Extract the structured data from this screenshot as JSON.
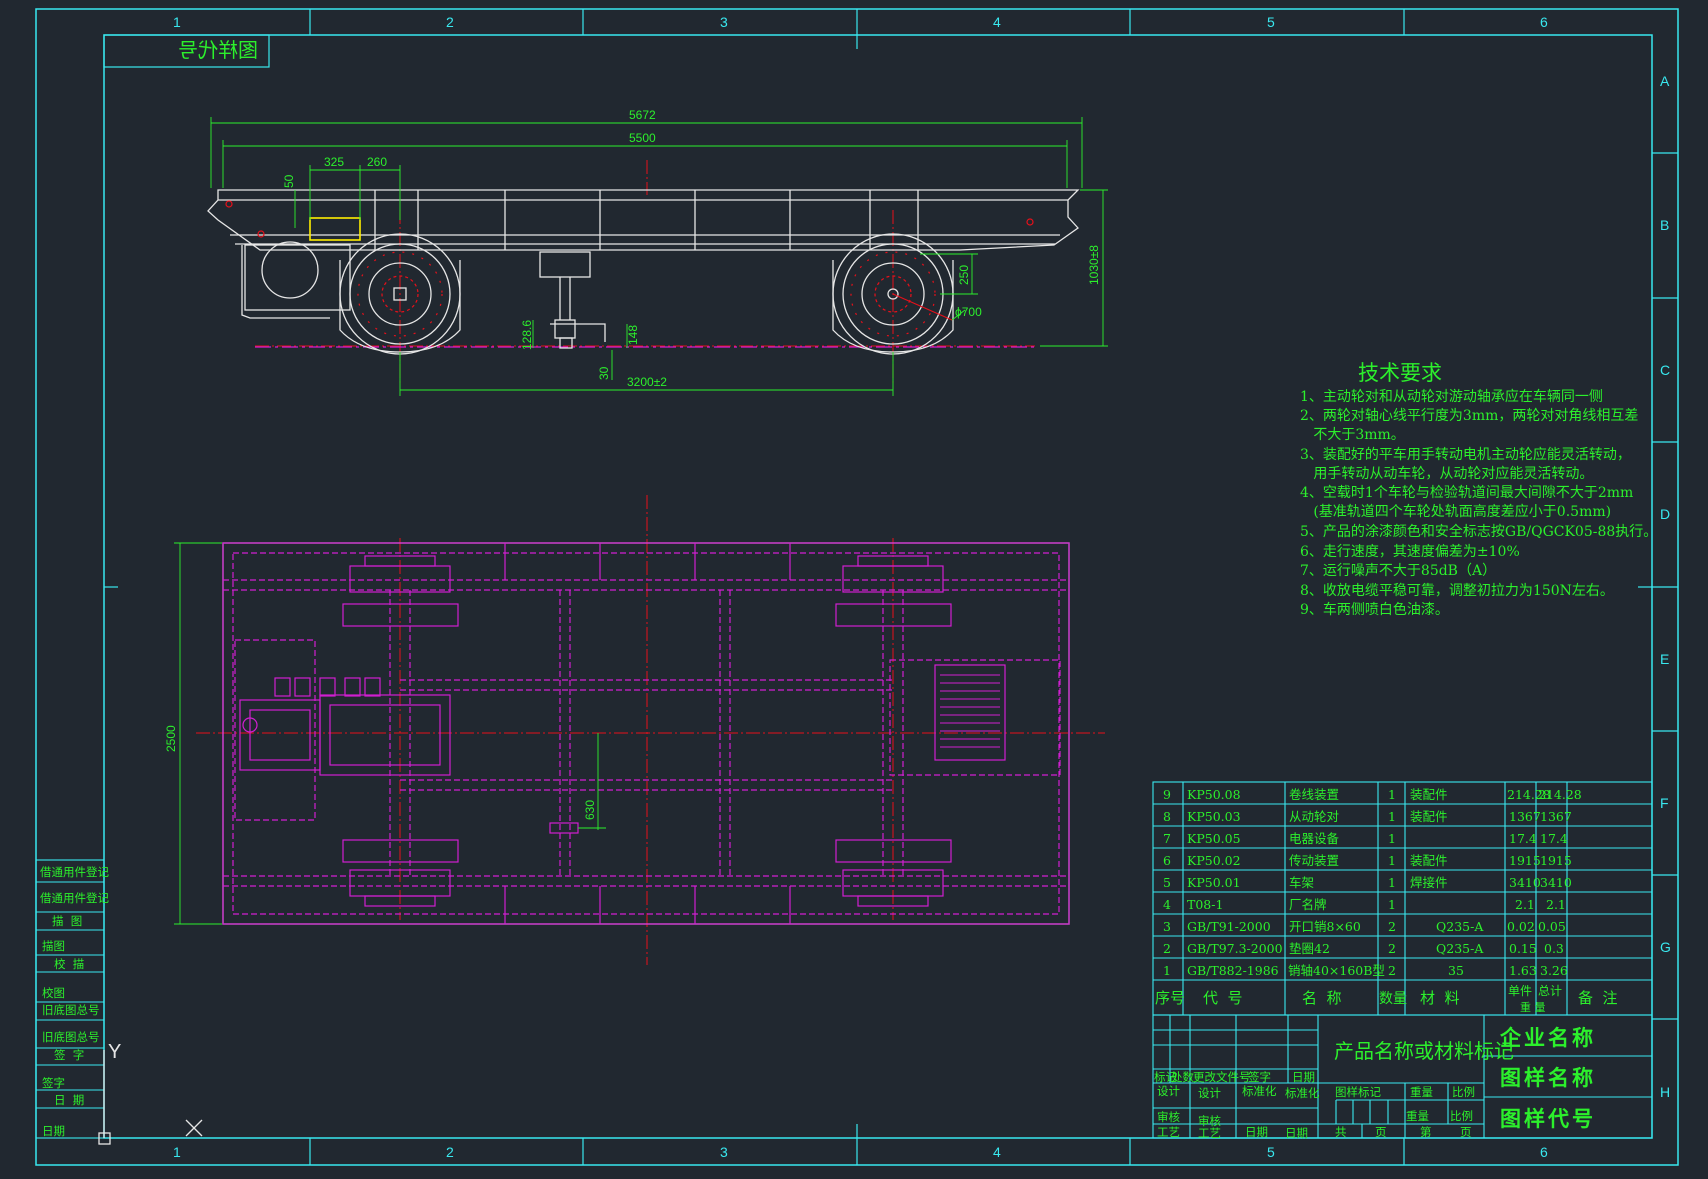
{
  "zone_columns": [
    "1",
    "2",
    "3",
    "4",
    "5",
    "6"
  ],
  "zone_rows": [
    "A",
    "B",
    "C",
    "D",
    "E",
    "F",
    "G",
    "H"
  ],
  "corner_mirrored_label": "图样代号",
  "dimensions": {
    "overall_length": "5672",
    "frame_length": "5500",
    "d325": "325",
    "d260": "260",
    "d50": "50",
    "height": "1030±8",
    "wheel_offset": "250",
    "wheel_dia": "ϕ700",
    "d128": "128.6",
    "d148": "148",
    "d30": "30",
    "wheelbase": "3200±2",
    "width": "2500",
    "d630": "630"
  },
  "tech_requirements": {
    "title": "技术要求",
    "lines": [
      "1、主动轮对和从动轮对游动轴承应在车辆同一侧",
      "2、两轮对轴心线平行度为3mm，两轮对对角线相互差",
      "   不大于3mm。",
      "3、装配好的平车用手转动电机主动轮应能灵活转动，",
      "   用手转动从动车轮，从动轮对应能灵活转动。",
      "4、空载时1个车轮与检验轨道间最大间隙不大于2mm",
      "   (基准轨道四个车轮处轨面高度差应小于0.5mm)",
      "5、产品的涂漆颜色和安全标志按GB/QGCK05-88执行。",
      "6、走行速度，其速度偏差为±10%",
      "7、运行噪声不大于85dB（A）",
      "8、收放电缆平稳可靠，调整初拉力为150N左右。",
      "9、车两侧喷白色油漆。"
    ]
  },
  "bom": {
    "rows": [
      {
        "seq": "9",
        "code": "KP50.08",
        "name": "卷线装置",
        "qty": "1",
        "mat": "装配件",
        "unit": "214.28",
        "total": "214.28"
      },
      {
        "seq": "8",
        "code": "KP50.03",
        "name": "从动轮对",
        "qty": "1",
        "mat": "装配件",
        "unit": "1367",
        "total": "1367"
      },
      {
        "seq": "7",
        "code": "KP50.05",
        "name": "电器设备",
        "qty": "1",
        "mat": "",
        "unit": "17.4",
        "total": "17.4"
      },
      {
        "seq": "6",
        "code": "KP50.02",
        "name": "传动装置",
        "qty": "1",
        "mat": "装配件",
        "unit": "1915",
        "total": "1915"
      },
      {
        "seq": "5",
        "code": "KP50.01",
        "name": "车架",
        "qty": "1",
        "mat": "焊接件",
        "unit": "3410",
        "total": "3410"
      },
      {
        "seq": "4",
        "code": "T08-1",
        "name": "厂名牌",
        "qty": "1",
        "mat": "",
        "unit": "2.1",
        "total": "2.1"
      },
      {
        "seq": "3",
        "code": "GB/T91-2000",
        "name": "开口销8×60",
        "qty": "2",
        "mat": "Q235-A",
        "unit": "0.02",
        "total": "0.05"
      },
      {
        "seq": "2",
        "code": "GB/T97.3-2000",
        "name": "垫圈42",
        "qty": "2",
        "mat": "Q235-A",
        "unit": "0.15",
        "total": "0.3"
      },
      {
        "seq": "1",
        "code": "GB/T882-1986",
        "name": "销轴40×160B型",
        "qty": "2",
        "mat": "35",
        "unit": "1.63",
        "total": "3.26"
      }
    ],
    "header": {
      "seq": "序号",
      "code": "代  号",
      "name": "名  称",
      "qty": "数量",
      "mat": "材  料",
      "unit": "单件",
      "total": "总计",
      "weight": "重 量",
      "remark": "备  注"
    }
  },
  "title_block": {
    "product": "产品名称或材料标记",
    "company": "企业名称",
    "drawing_name": "图样名称",
    "drawing_code": "图样代号",
    "rev_headers": [
      "标记",
      "处数",
      "更改文件号",
      "签字",
      "日期"
    ],
    "r1": [
      "设计",
      "设计",
      "标准化",
      "标准化"
    ],
    "r2": [
      "审核",
      "审核"
    ],
    "r3": [
      "工艺",
      "工艺",
      "日期",
      "日期"
    ],
    "mark": "图样标记",
    "weight": "重量",
    "scale": "比例",
    "weight2": "重量",
    "scale2": "比例",
    "total": "共",
    "sheet": "页",
    "nth": "第",
    "page": "页"
  },
  "side_stamps": [
    "借通用件登记",
    "借通用件登记",
    "描  图",
    "描图",
    "校  描",
    "校图",
    "旧底图总号",
    "旧底图总号",
    "签  字",
    "签字",
    "日  期",
    "日期"
  ],
  "axis_y_label": "Y"
}
